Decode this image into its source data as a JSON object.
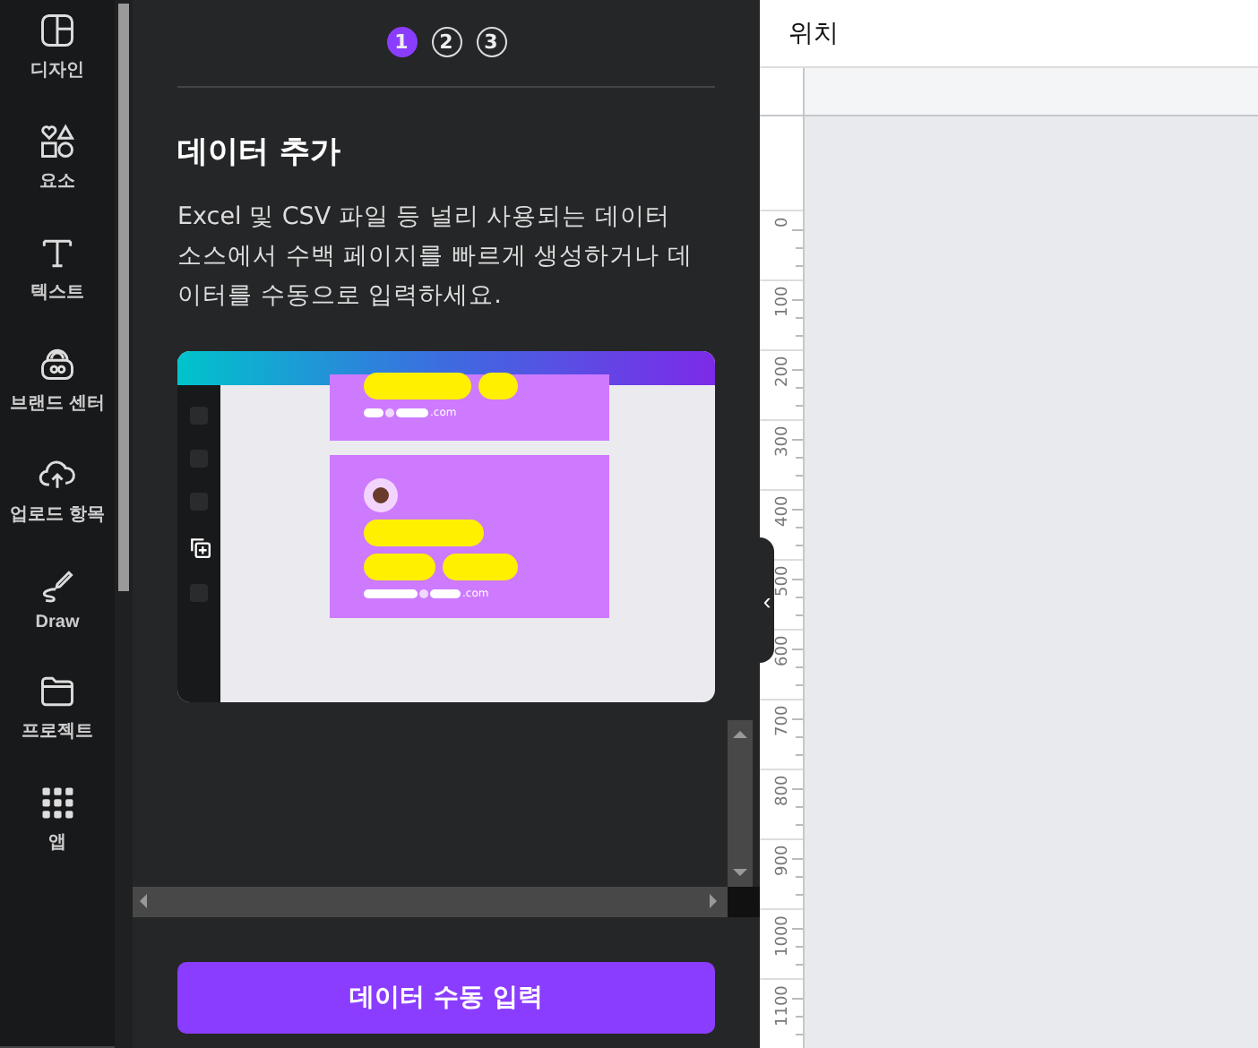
{
  "rail": {
    "items": [
      {
        "label": "디자인"
      },
      {
        "label": "요소"
      },
      {
        "label": "텍스트"
      },
      {
        "label": "브랜드 센터"
      },
      {
        "label": "업로드 항목"
      },
      {
        "label": "Draw"
      },
      {
        "label": "프로젝트"
      },
      {
        "label": "앱"
      }
    ]
  },
  "panel": {
    "steps": [
      {
        "label": "1",
        "selected": true
      },
      {
        "label": "2",
        "selected": false
      },
      {
        "label": "3",
        "selected": false
      }
    ],
    "title": "데이터 추가",
    "description": "Excel 및 CSV 파일 등 널리 사용되는 데이터 소스에서 수백 페이지를 빠르게 생성하거나 데이터를 수동으로 입력하세요.",
    "preview": {
      "card_texts": [
        ".com",
        ".com"
      ]
    },
    "button": "데이터 수동 입력",
    "collapse_handle": "‹"
  },
  "editor": {
    "header": "위치",
    "ruler_labels": [
      "0",
      "100",
      "200",
      "300",
      "400",
      "500",
      "600",
      "700",
      "800",
      "900",
      "1000",
      "1100"
    ]
  }
}
